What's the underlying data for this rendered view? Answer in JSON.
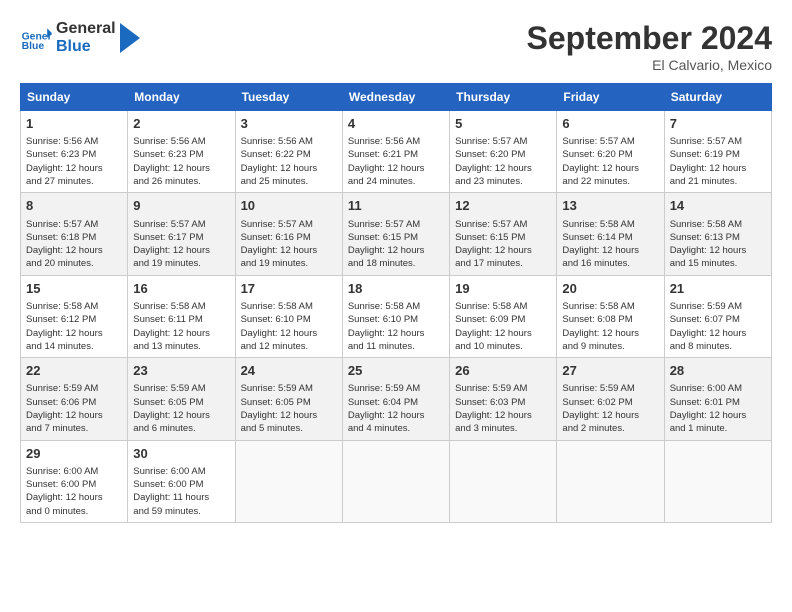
{
  "header": {
    "logo_line1": "General",
    "logo_line2": "Blue",
    "month": "September 2024",
    "location": "El Calvario, Mexico"
  },
  "columns": [
    "Sunday",
    "Monday",
    "Tuesday",
    "Wednesday",
    "Thursday",
    "Friday",
    "Saturday"
  ],
  "weeks": [
    [
      {
        "day": "1",
        "lines": [
          "Sunrise: 5:56 AM",
          "Sunset: 6:23 PM",
          "Daylight: 12 hours",
          "and 27 minutes."
        ]
      },
      {
        "day": "2",
        "lines": [
          "Sunrise: 5:56 AM",
          "Sunset: 6:23 PM",
          "Daylight: 12 hours",
          "and 26 minutes."
        ]
      },
      {
        "day": "3",
        "lines": [
          "Sunrise: 5:56 AM",
          "Sunset: 6:22 PM",
          "Daylight: 12 hours",
          "and 25 minutes."
        ]
      },
      {
        "day": "4",
        "lines": [
          "Sunrise: 5:56 AM",
          "Sunset: 6:21 PM",
          "Daylight: 12 hours",
          "and 24 minutes."
        ]
      },
      {
        "day": "5",
        "lines": [
          "Sunrise: 5:57 AM",
          "Sunset: 6:20 PM",
          "Daylight: 12 hours",
          "and 23 minutes."
        ]
      },
      {
        "day": "6",
        "lines": [
          "Sunrise: 5:57 AM",
          "Sunset: 6:20 PM",
          "Daylight: 12 hours",
          "and 22 minutes."
        ]
      },
      {
        "day": "7",
        "lines": [
          "Sunrise: 5:57 AM",
          "Sunset: 6:19 PM",
          "Daylight: 12 hours",
          "and 21 minutes."
        ]
      }
    ],
    [
      {
        "day": "8",
        "lines": [
          "Sunrise: 5:57 AM",
          "Sunset: 6:18 PM",
          "Daylight: 12 hours",
          "and 20 minutes."
        ]
      },
      {
        "day": "9",
        "lines": [
          "Sunrise: 5:57 AM",
          "Sunset: 6:17 PM",
          "Daylight: 12 hours",
          "and 19 minutes."
        ]
      },
      {
        "day": "10",
        "lines": [
          "Sunrise: 5:57 AM",
          "Sunset: 6:16 PM",
          "Daylight: 12 hours",
          "and 19 minutes."
        ]
      },
      {
        "day": "11",
        "lines": [
          "Sunrise: 5:57 AM",
          "Sunset: 6:15 PM",
          "Daylight: 12 hours",
          "and 18 minutes."
        ]
      },
      {
        "day": "12",
        "lines": [
          "Sunrise: 5:57 AM",
          "Sunset: 6:15 PM",
          "Daylight: 12 hours",
          "and 17 minutes."
        ]
      },
      {
        "day": "13",
        "lines": [
          "Sunrise: 5:58 AM",
          "Sunset: 6:14 PM",
          "Daylight: 12 hours",
          "and 16 minutes."
        ]
      },
      {
        "day": "14",
        "lines": [
          "Sunrise: 5:58 AM",
          "Sunset: 6:13 PM",
          "Daylight: 12 hours",
          "and 15 minutes."
        ]
      }
    ],
    [
      {
        "day": "15",
        "lines": [
          "Sunrise: 5:58 AM",
          "Sunset: 6:12 PM",
          "Daylight: 12 hours",
          "and 14 minutes."
        ]
      },
      {
        "day": "16",
        "lines": [
          "Sunrise: 5:58 AM",
          "Sunset: 6:11 PM",
          "Daylight: 12 hours",
          "and 13 minutes."
        ]
      },
      {
        "day": "17",
        "lines": [
          "Sunrise: 5:58 AM",
          "Sunset: 6:10 PM",
          "Daylight: 12 hours",
          "and 12 minutes."
        ]
      },
      {
        "day": "18",
        "lines": [
          "Sunrise: 5:58 AM",
          "Sunset: 6:10 PM",
          "Daylight: 12 hours",
          "and 11 minutes."
        ]
      },
      {
        "day": "19",
        "lines": [
          "Sunrise: 5:58 AM",
          "Sunset: 6:09 PM",
          "Daylight: 12 hours",
          "and 10 minutes."
        ]
      },
      {
        "day": "20",
        "lines": [
          "Sunrise: 5:58 AM",
          "Sunset: 6:08 PM",
          "Daylight: 12 hours",
          "and 9 minutes."
        ]
      },
      {
        "day": "21",
        "lines": [
          "Sunrise: 5:59 AM",
          "Sunset: 6:07 PM",
          "Daylight: 12 hours",
          "and 8 minutes."
        ]
      }
    ],
    [
      {
        "day": "22",
        "lines": [
          "Sunrise: 5:59 AM",
          "Sunset: 6:06 PM",
          "Daylight: 12 hours",
          "and 7 minutes."
        ]
      },
      {
        "day": "23",
        "lines": [
          "Sunrise: 5:59 AM",
          "Sunset: 6:05 PM",
          "Daylight: 12 hours",
          "and 6 minutes."
        ]
      },
      {
        "day": "24",
        "lines": [
          "Sunrise: 5:59 AM",
          "Sunset: 6:05 PM",
          "Daylight: 12 hours",
          "and 5 minutes."
        ]
      },
      {
        "day": "25",
        "lines": [
          "Sunrise: 5:59 AM",
          "Sunset: 6:04 PM",
          "Daylight: 12 hours",
          "and 4 minutes."
        ]
      },
      {
        "day": "26",
        "lines": [
          "Sunrise: 5:59 AM",
          "Sunset: 6:03 PM",
          "Daylight: 12 hours",
          "and 3 minutes."
        ]
      },
      {
        "day": "27",
        "lines": [
          "Sunrise: 5:59 AM",
          "Sunset: 6:02 PM",
          "Daylight: 12 hours",
          "and 2 minutes."
        ]
      },
      {
        "day": "28",
        "lines": [
          "Sunrise: 6:00 AM",
          "Sunset: 6:01 PM",
          "Daylight: 12 hours",
          "and 1 minute."
        ]
      }
    ],
    [
      {
        "day": "29",
        "lines": [
          "Sunrise: 6:00 AM",
          "Sunset: 6:00 PM",
          "Daylight: 12 hours",
          "and 0 minutes."
        ]
      },
      {
        "day": "30",
        "lines": [
          "Sunrise: 6:00 AM",
          "Sunset: 6:00 PM",
          "Daylight: 11 hours",
          "and 59 minutes."
        ]
      },
      null,
      null,
      null,
      null,
      null
    ]
  ]
}
